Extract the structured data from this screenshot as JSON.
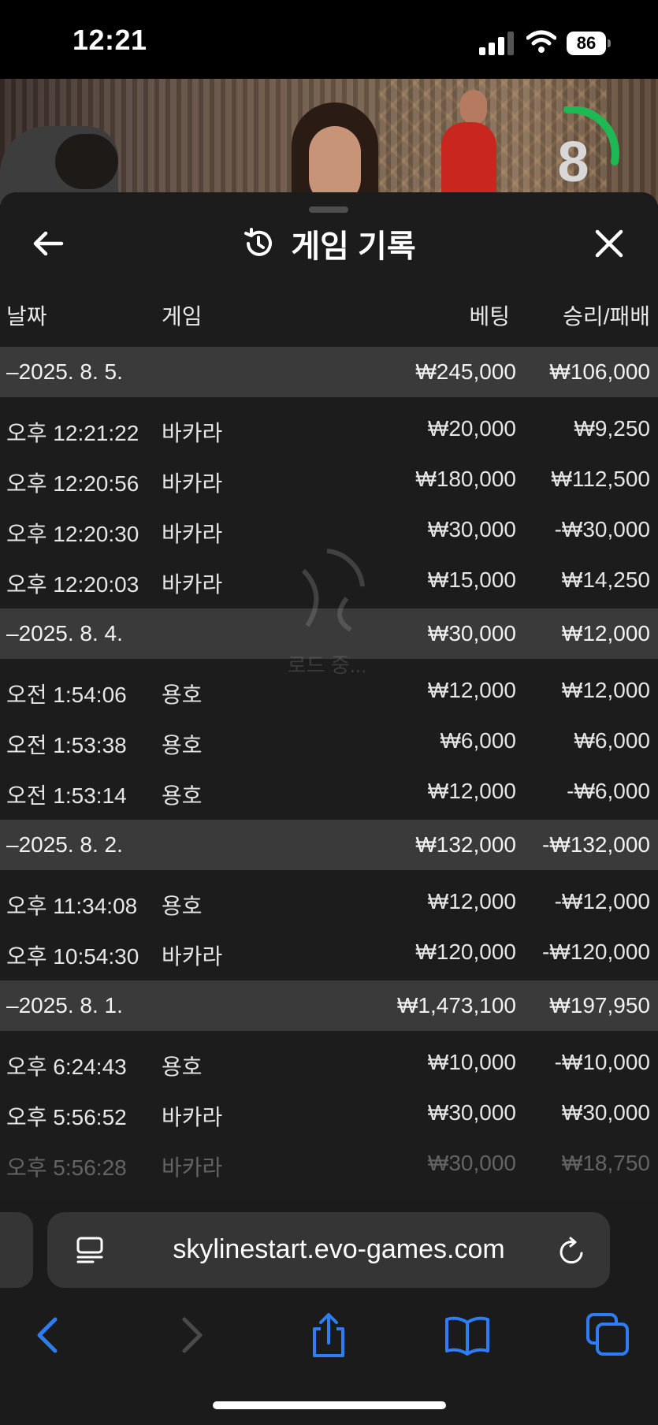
{
  "status_bar": {
    "time": "12:21",
    "battery": "86"
  },
  "video": {
    "countdown": "8"
  },
  "sheet": {
    "title": "게임 기록",
    "columns": {
      "date": "날짜",
      "game": "게임",
      "bet": "베팅",
      "result": "승리/패배"
    },
    "loading_text": "로드 중..."
  },
  "groups": [
    {
      "date": "–2025. 8. 5.",
      "bet_total": "₩245,000",
      "result_total": "₩106,000",
      "rows": [
        {
          "time": "오후 12:21:22",
          "game": "바카라",
          "bet": "₩20,000",
          "result": "₩9,250"
        },
        {
          "time": "오후 12:20:56",
          "game": "바카라",
          "bet": "₩180,000",
          "result": "₩112,500"
        },
        {
          "time": "오후 12:20:30",
          "game": "바카라",
          "bet": "₩30,000",
          "result": "-₩30,000"
        },
        {
          "time": "오후 12:20:03",
          "game": "바카라",
          "bet": "₩15,000",
          "result": "₩14,250"
        }
      ]
    },
    {
      "date": "–2025. 8. 4.",
      "bet_total": "₩30,000",
      "result_total": "₩12,000",
      "rows": [
        {
          "time": "오전 1:54:06",
          "game": "용호",
          "bet": "₩12,000",
          "result": "₩12,000"
        },
        {
          "time": "오전 1:53:38",
          "game": "용호",
          "bet": "₩6,000",
          "result": "₩6,000"
        },
        {
          "time": "오전 1:53:14",
          "game": "용호",
          "bet": "₩12,000",
          "result": "-₩6,000"
        }
      ]
    },
    {
      "date": "–2025. 8. 2.",
      "bet_total": "₩132,000",
      "result_total": "-₩132,000",
      "rows": [
        {
          "time": "오후 11:34:08",
          "game": "용호",
          "bet": "₩12,000",
          "result": "-₩12,000"
        },
        {
          "time": "오후 10:54:30",
          "game": "바카라",
          "bet": "₩120,000",
          "result": "-₩120,000"
        }
      ]
    },
    {
      "date": "–2025. 8. 1.",
      "bet_total": "₩1,473,100",
      "result_total": "₩197,950",
      "rows": [
        {
          "time": "오후 6:24:43",
          "game": "용호",
          "bet": "₩10,000",
          "result": "-₩10,000"
        },
        {
          "time": "오후 5:56:52",
          "game": "바카라",
          "bet": "₩30,000",
          "result": "₩30,000"
        },
        {
          "time": "오후 5:56:28",
          "game": "바카라",
          "bet": "₩30,000",
          "result": "₩18,750"
        }
      ]
    }
  ],
  "browser": {
    "url": "skylinestart.evo-games.com"
  },
  "colors": {
    "sheet_bg": "#1c1c1c",
    "date_row_bg": "#3a3a3a",
    "accent_blue": "#2f7df6",
    "timer_green": "#1db954"
  }
}
